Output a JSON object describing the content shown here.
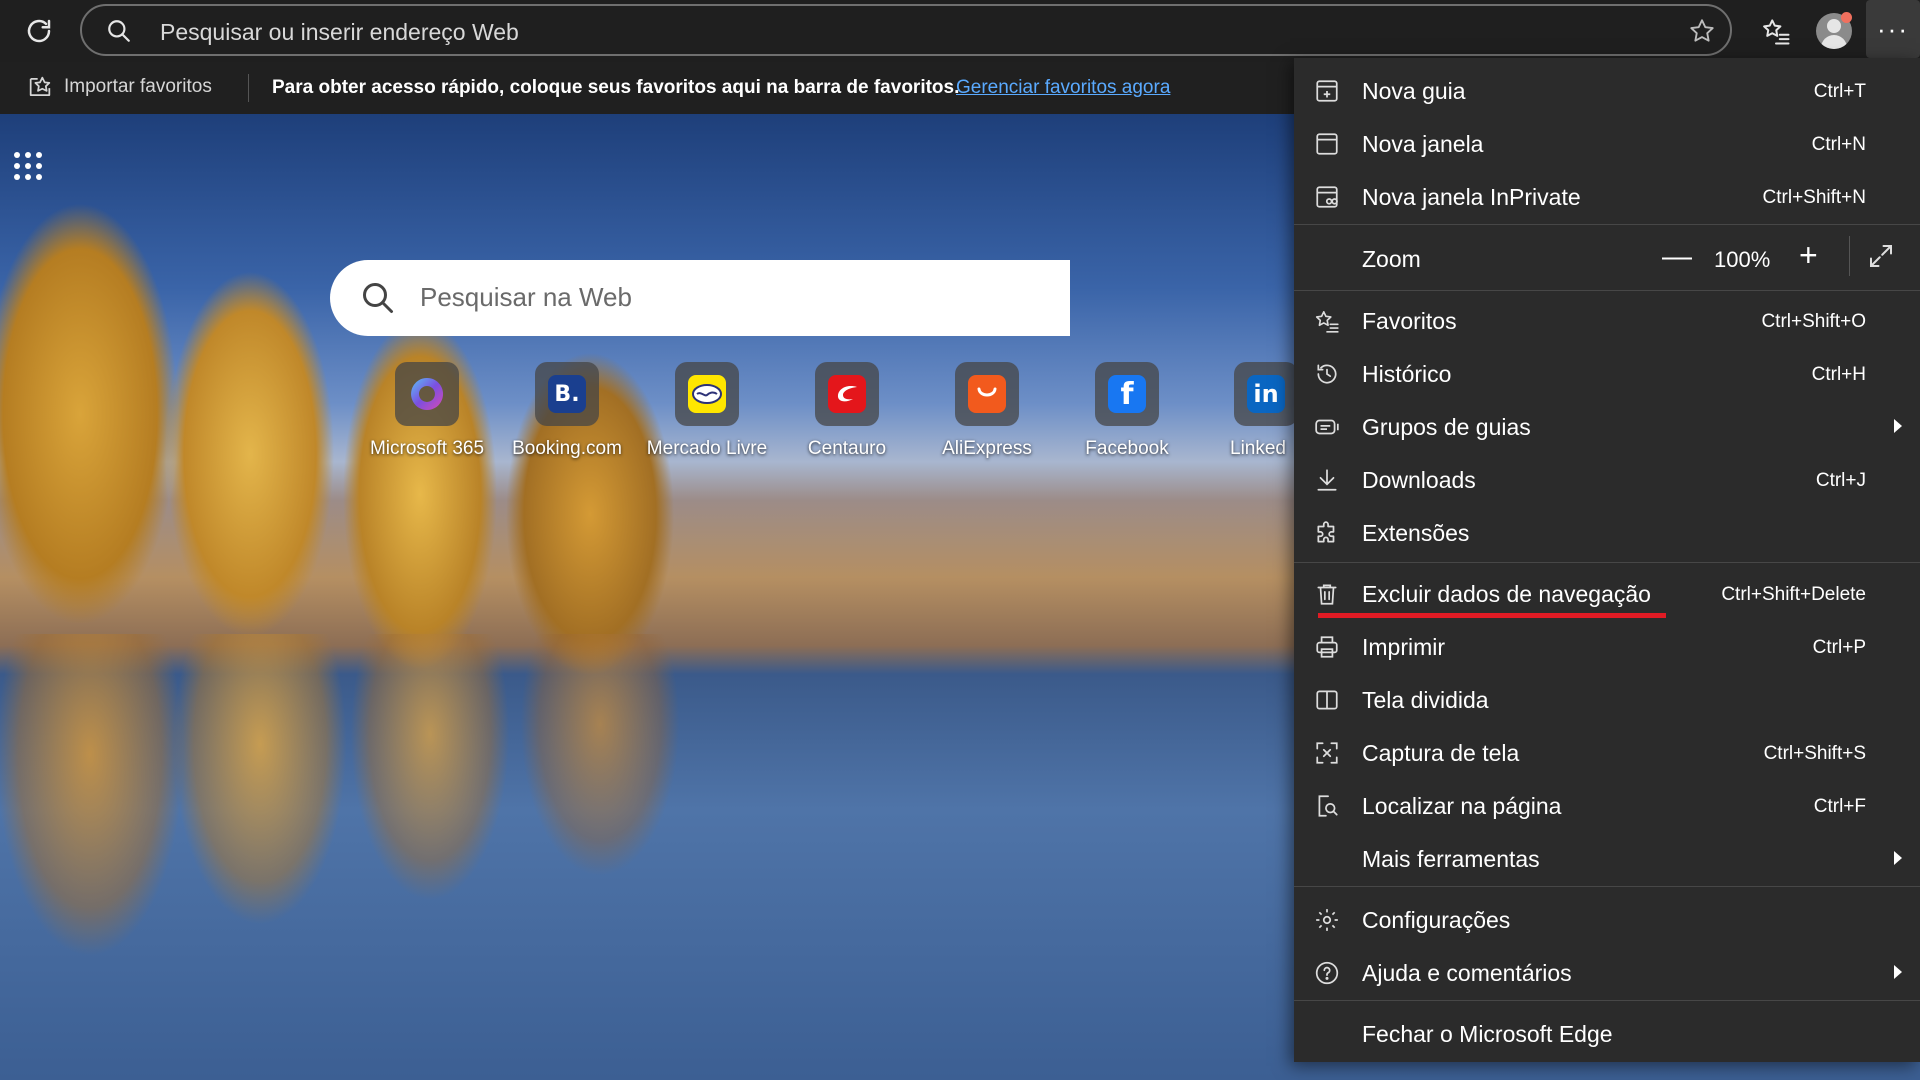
{
  "toolbar": {
    "address_placeholder": "Pesquisar ou inserir endereço Web",
    "more_label": "···"
  },
  "favorites_bar": {
    "import_label": "Importar favoritos",
    "hint": "Para obter acesso rápido, coloque seus favoritos aqui na barra de favoritos.",
    "manage_link": "Gerenciar favoritos agora"
  },
  "newtab": {
    "search_placeholder": "Pesquisar na Web",
    "quick_links": [
      {
        "label": "Microsoft 365",
        "logo_text": "",
        "color": "#3b3bd6"
      },
      {
        "label": "Booking.com",
        "logo_text": "B.",
        "color": "#1a3f8f"
      },
      {
        "label": "Mercado Livre",
        "logo_text": "",
        "color": "#ffe600"
      },
      {
        "label": "Centauro",
        "logo_text": "",
        "color": "#e4161b"
      },
      {
        "label": "AliExpress",
        "logo_text": "",
        "color": "#f25a1d"
      },
      {
        "label": "Facebook",
        "logo_text": "f",
        "color": "#1877f2"
      },
      {
        "label": "Linked",
        "logo_text": "in",
        "color": "#0a66c2"
      }
    ]
  },
  "menu": {
    "items": [
      {
        "label": "Nova guia",
        "shortcut": "Ctrl+T",
        "icon": "new-tab-icon"
      },
      {
        "label": "Nova janela",
        "shortcut": "Ctrl+N",
        "icon": "new-window-icon"
      },
      {
        "label": "Nova janela InPrivate",
        "shortcut": "Ctrl+Shift+N",
        "icon": "inprivate-icon"
      },
      {
        "label": "Favoritos",
        "shortcut": "Ctrl+Shift+O",
        "icon": "favorites-icon"
      },
      {
        "label": "Histórico",
        "shortcut": "Ctrl+H",
        "icon": "history-icon"
      },
      {
        "label": "Grupos de guias",
        "shortcut": "",
        "icon": "tab-groups-icon",
        "submenu": true
      },
      {
        "label": "Downloads",
        "shortcut": "Ctrl+J",
        "icon": "download-icon"
      },
      {
        "label": "Extensões",
        "shortcut": "",
        "icon": "extensions-icon"
      },
      {
        "label": "Excluir dados de navegação",
        "shortcut": "Ctrl+Shift+Delete",
        "icon": "trash-icon"
      },
      {
        "label": "Imprimir",
        "shortcut": "Ctrl+P",
        "icon": "print-icon"
      },
      {
        "label": "Tela dividida",
        "shortcut": "",
        "icon": "split-screen-icon"
      },
      {
        "label": "Captura de tela",
        "shortcut": "Ctrl+Shift+S",
        "icon": "screenshot-icon"
      },
      {
        "label": "Localizar na página",
        "shortcut": "Ctrl+F",
        "icon": "find-icon"
      },
      {
        "label": "Mais ferramentas",
        "shortcut": "",
        "icon": "",
        "submenu": true
      },
      {
        "label": "Configurações",
        "shortcut": "",
        "icon": "gear-icon"
      },
      {
        "label": "Ajuda e comentários",
        "shortcut": "",
        "icon": "help-icon",
        "submenu": true
      },
      {
        "label": "Fechar o Microsoft Edge",
        "shortcut": "",
        "icon": ""
      }
    ],
    "zoom": {
      "label": "Zoom",
      "value": "100%",
      "minus": "—",
      "plus": "+"
    }
  },
  "colors": {
    "menu_bg": "#2b2b2b",
    "toolbar_bg": "#1f1f1f",
    "link": "#5aaaff",
    "highlight_underline": "#e01b24"
  }
}
